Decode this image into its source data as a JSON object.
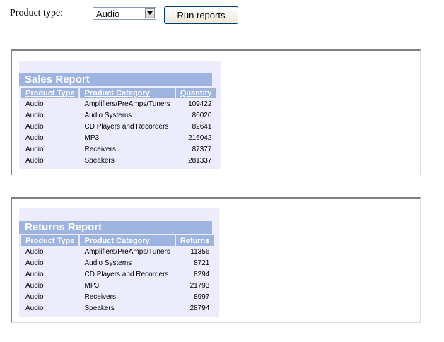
{
  "toolbar": {
    "product_type_label": "Product type:",
    "product_type_selected": "Audio",
    "run_button_label": "Run reports"
  },
  "sales_report": {
    "title": "Sales Report",
    "columns": [
      "Product Type",
      "Product Category",
      "Quantity"
    ],
    "rows": [
      [
        "Audio",
        "Amplifiers/PreAmps/Tuners",
        "109422"
      ],
      [
        "Audio",
        "Audio Systems",
        "86020"
      ],
      [
        "Audio",
        "CD Players and Recorders",
        "82641"
      ],
      [
        "Audio",
        "MP3",
        "216042"
      ],
      [
        "Audio",
        "Receivers",
        "87377"
      ],
      [
        "Audio",
        "Speakers",
        "281337"
      ]
    ]
  },
  "returns_report": {
    "title": "Returns Report",
    "columns": [
      "Product Type",
      "Product Category",
      "Returns"
    ],
    "rows": [
      [
        "Audio",
        "Amplifiers/PreAmps/Tuners",
        "11356"
      ],
      [
        "Audio",
        "Audio Systems",
        "8721"
      ],
      [
        "Audio",
        "CD Players and Recorders",
        "8294"
      ],
      [
        "Audio",
        "MP3",
        "21793"
      ],
      [
        "Audio",
        "Receivers",
        "8997"
      ],
      [
        "Audio",
        "Speakers",
        "28794"
      ]
    ]
  },
  "colors": {
    "header_bg": "#9eb4e0",
    "report_bg": "#ececfc"
  },
  "icons": {
    "dropdown": "chevron-down-icon"
  }
}
